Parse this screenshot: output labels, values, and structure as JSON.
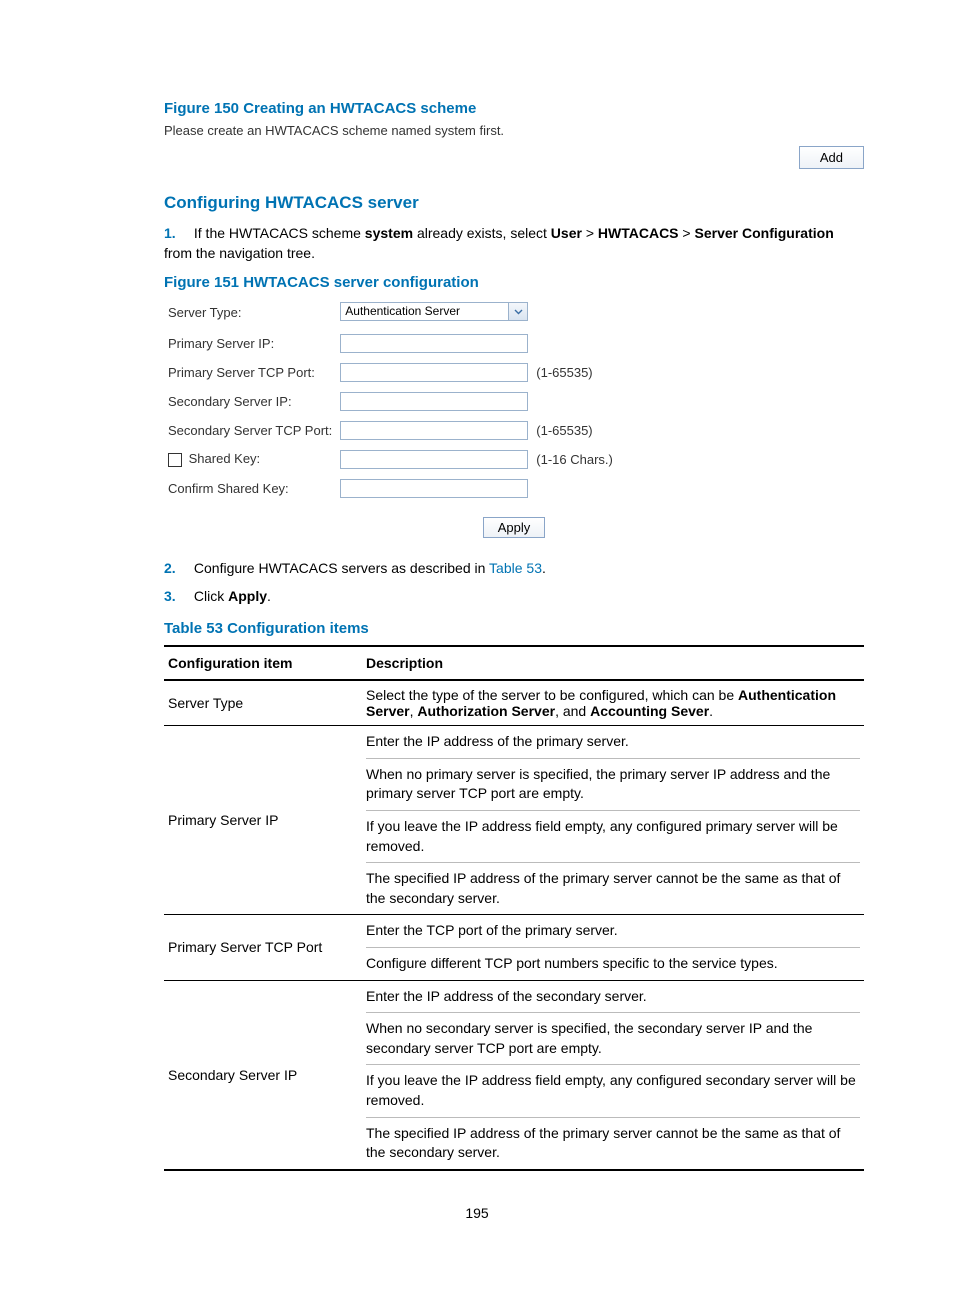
{
  "figure150": {
    "caption": "Figure 150 Creating an HWTACACS scheme",
    "instruction": "Please create an HWTACACS scheme named system first.",
    "add_button": "Add"
  },
  "section": {
    "heading": "Configuring HWTACACS server"
  },
  "steps": {
    "s1_num": "1.",
    "s1_pre": "If the HWTACACS scheme ",
    "s1_b1": "system",
    "s1_mid1": " already exists, select ",
    "s1_b2": "User",
    "s1_sep1": " > ",
    "s1_b3": "HWTACACS",
    "s1_sep2": " > ",
    "s1_b4": "Server Configuration",
    "s1_post": " from the navigation tree.",
    "s2_num": "2.",
    "s2_pre": "Configure HWTACACS servers as described in ",
    "s2_link": "Table 53",
    "s2_post": ".",
    "s3_num": "3.",
    "s3_pre": "Click ",
    "s3_b": "Apply",
    "s3_post": "."
  },
  "figure151": {
    "caption": "Figure 151 HWTACACS server configuration",
    "form": {
      "server_type_label": "Server Type:",
      "server_type_value": "Authentication Server",
      "primary_ip_label": "Primary Server IP:",
      "primary_port_label": "Primary Server TCP Port:",
      "primary_port_hint": "(1-65535)",
      "secondary_ip_label": "Secondary Server IP:",
      "secondary_port_label": "Secondary Server TCP Port:",
      "secondary_port_hint": "(1-65535)",
      "shared_key_label": "Shared Key:",
      "shared_key_hint": "(1-16 Chars.)",
      "confirm_key_label": "Confirm Shared Key:",
      "apply_button": "Apply"
    }
  },
  "table53": {
    "caption": "Table 53 Configuration items",
    "header_item": "Configuration item",
    "header_desc": "Description",
    "rows": [
      {
        "item": "Server Type",
        "desc_pre": "Select the type of the server to be configured, which can be ",
        "desc_b1": "Authentication Server",
        "desc_sep1": ", ",
        "desc_b2": "Authorization Server",
        "desc_sep2": ", and ",
        "desc_b3": "Accounting Sever",
        "desc_post": "."
      },
      {
        "item": "Primary Server IP",
        "paras": [
          "Enter the IP address of the primary server.",
          "When no primary server is specified, the primary server IP address and the primary server TCP port are empty.",
          "If you leave the IP address field empty, any configured primary server will be removed.",
          "The specified IP address of the primary server cannot be the same as that of the secondary server."
        ]
      },
      {
        "item": "Primary Server TCP Port",
        "paras": [
          "Enter the TCP port of the primary server.",
          "Configure different TCP port numbers specific to the service types."
        ]
      },
      {
        "item": "Secondary Server IP",
        "paras": [
          "Enter the IP address of the secondary server.",
          "When no secondary server is specified, the secondary server IP and the secondary server TCP port are empty.",
          "If you leave the IP address field empty, any configured secondary server will be removed.",
          "The specified IP address of the primary server cannot be the same as that of the secondary server."
        ]
      }
    ]
  },
  "page_number": "195"
}
